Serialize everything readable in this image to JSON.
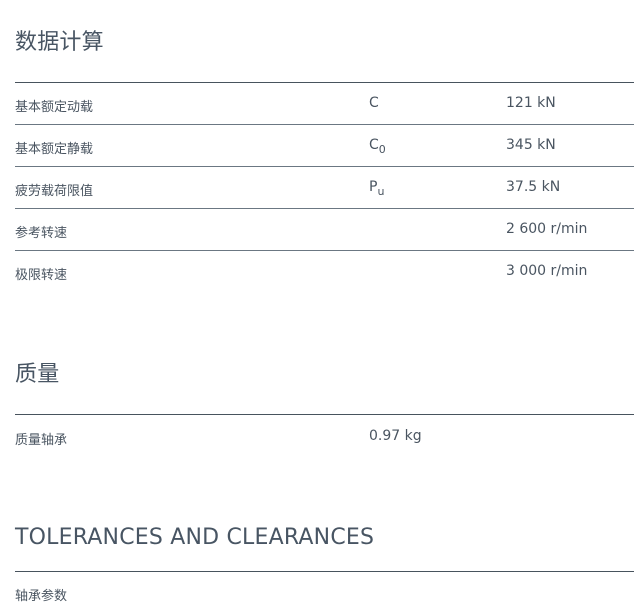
{
  "calculation": {
    "title": "数据计算",
    "rows": [
      {
        "label": "基本额定动载",
        "symbol": "C",
        "symbol_sub": "",
        "value": "121 kN"
      },
      {
        "label": "基本额定静载",
        "symbol": "C",
        "symbol_sub": "0",
        "value": "345 kN"
      },
      {
        "label": "疲劳载荷限值",
        "symbol": "P",
        "symbol_sub": "u",
        "value": "37.5 kN"
      },
      {
        "label": "参考转速",
        "symbol": "",
        "symbol_sub": "",
        "value": "2 600 r/min"
      },
      {
        "label": "极限转速",
        "symbol": "",
        "symbol_sub": "",
        "value": "3 000 r/min"
      }
    ]
  },
  "mass": {
    "title": "质量",
    "rows": [
      {
        "label": "质量轴承",
        "value": "0.97 kg"
      }
    ]
  },
  "tolerances": {
    "title": "TOLERANCES AND CLEARANCES",
    "first_row_label": "轴承参数"
  }
}
